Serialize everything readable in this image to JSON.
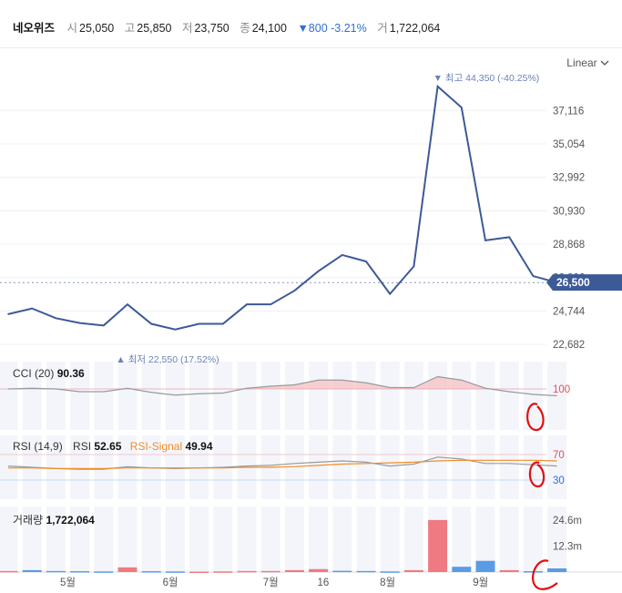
{
  "header": {
    "stock_name": "네오위즈",
    "open_label": "시",
    "open": "25,050",
    "high_label": "고",
    "high": "25,850",
    "low_label": "저",
    "low": "23,750",
    "close_label": "종",
    "close": "24,100",
    "change": "▼800 -3.21%",
    "volume_label": "거",
    "volume": "1,722,064"
  },
  "scale_toggle": {
    "label": "Linear",
    "icon": "chevron-down-icon"
  },
  "colors": {
    "price_line": "#3d5a98",
    "up": "#f07a82",
    "down": "#5a9be6",
    "signal": "#f28c28",
    "blue_text": "#2f6fd6"
  },
  "chart_data": {
    "type": "line",
    "x_tick_labels": [
      "5월",
      "6월",
      "7월",
      "16",
      "8월",
      "9월"
    ],
    "price": {
      "y_ticks": [
        22682,
        24744,
        26806,
        28868,
        30930,
        32992,
        35054,
        37116
      ],
      "y_tick_labels": [
        "22,682",
        "24,744",
        "26,806",
        "28,868",
        "30,930",
        "32,992",
        "35,054",
        "37,116"
      ],
      "ylim": [
        21900,
        40000
      ],
      "values": [
        24550,
        24900,
        24300,
        24000,
        23850,
        25150,
        23950,
        23600,
        23950,
        23950,
        25150,
        25150,
        26000,
        27200,
        28200,
        27800,
        25800,
        27500,
        38600,
        37300,
        29100,
        29300,
        26900,
        26500
      ],
      "last_price_label": "26,500",
      "max_annotation": "▼ 최고 44,350 (-40.25%)",
      "min_annotation": "▲ 최저 22,550 (17.52%)"
    },
    "cci": {
      "title": "CCI (20)",
      "value": "90.36",
      "level": 100,
      "level_label": "100",
      "ylim": [
        -200,
        300
      ],
      "values": [
        100,
        105,
        100,
        80,
        80,
        105,
        75,
        55,
        65,
        70,
        105,
        120,
        130,
        165,
        165,
        145,
        110,
        110,
        190,
        165,
        105,
        80,
        60,
        50
      ]
    },
    "rsi": {
      "title": "RSI (14,9)",
      "rsi_label": "RSI",
      "rsi_value": "52.65",
      "signal_label": "RSI-Signal",
      "signal_value": "49.94",
      "level_high": "70",
      "level_low": "30",
      "ylim": [
        0,
        100
      ],
      "rsi_values": [
        52,
        50,
        48,
        47,
        47,
        51,
        49,
        48,
        49,
        50,
        52,
        53,
        56,
        58,
        60,
        58,
        52,
        55,
        66,
        63,
        56,
        56,
        54,
        52
      ],
      "signal_values": [
        49,
        49,
        48,
        48,
        48,
        49,
        49,
        49,
        49,
        49,
        50,
        50,
        51,
        53,
        55,
        56,
        57,
        58,
        60,
        61,
        61,
        61,
        61,
        60
      ]
    },
    "volume": {
      "title": "거래량",
      "value": "1,722,064",
      "y_tick_labels": [
        "24.6m",
        "12.3m"
      ],
      "y_ticks": [
        24600000,
        12300000
      ],
      "ylim": [
        0,
        31000000
      ],
      "values": [
        500000,
        900000,
        500000,
        400000,
        300000,
        2200000,
        400000,
        300000,
        200000,
        300000,
        500000,
        500000,
        900000,
        1400000,
        600000,
        500000,
        300000,
        900000,
        24600000,
        2500000,
        5300000,
        900000,
        400000,
        1722064
      ],
      "up": [
        true,
        false,
        false,
        false,
        false,
        true,
        false,
        false,
        true,
        true,
        true,
        true,
        true,
        true,
        false,
        false,
        false,
        true,
        true,
        false,
        false,
        true,
        false,
        false
      ]
    }
  }
}
